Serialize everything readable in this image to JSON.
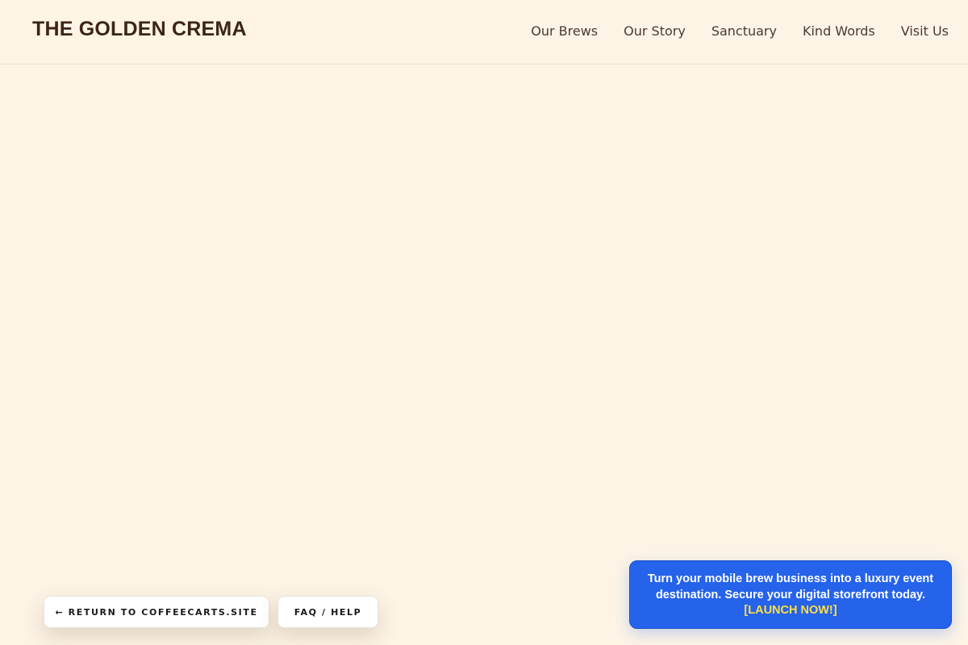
{
  "header": {
    "brand": "THE GOLDEN CREMA",
    "nav": [
      "Our Brews",
      "Our Story",
      "Sanctuary",
      "Kind Words",
      "Visit Us"
    ]
  },
  "footer_buttons": {
    "return_label": "← RETURN TO COFFEECARTS.SITE",
    "faq_label": "FAQ / HELP"
  },
  "promo": {
    "text": "Turn your mobile brew business into a luxury event destination. Secure your digital storefront today.",
    "cta": "[LAUNCH NOW!]"
  },
  "colors": {
    "background": "#fdf4e6",
    "brand_text": "#3b2516",
    "promo_bg": "#2563eb",
    "promo_cta": "#fde047"
  }
}
